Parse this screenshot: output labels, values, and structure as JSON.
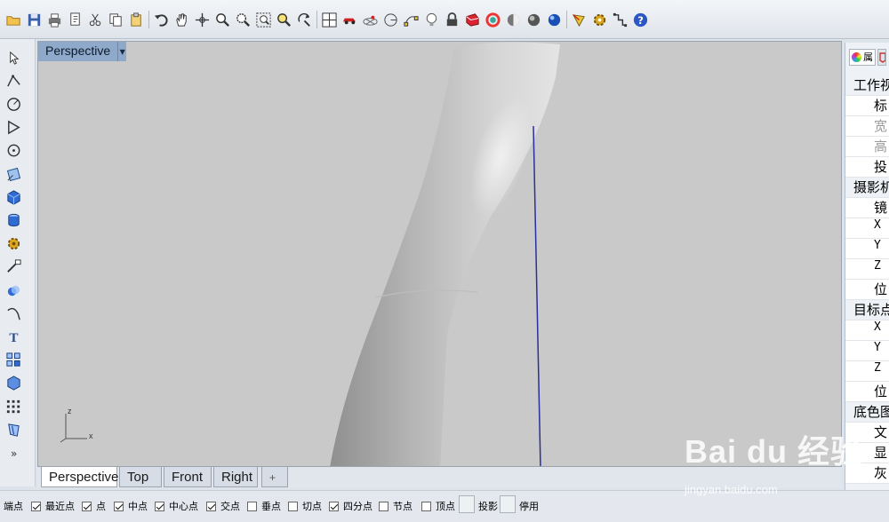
{
  "toolbar": {
    "icons": [
      "open-icon",
      "save-icon",
      "print-icon",
      "import-icon",
      "cut-icon",
      "copy-icon",
      "paste-icon",
      "undo-icon",
      "pan-hand-icon",
      "rotate-view-icon",
      "zoom-icon",
      "zoom-window-icon",
      "zoom-extents-icon",
      "zoom-selected-icon",
      "rotate-icon",
      "four-viewports-icon",
      "car-icon",
      "grid-icon",
      "osnap-icon",
      "point-edit-icon",
      "light-icon",
      "lock-icon",
      "layer-icon",
      "color-wheel-icon",
      "shaded-icon",
      "rendered-icon",
      "render-sphere-icon",
      "pen-icon",
      "gear-icon",
      "steps-icon",
      "help-icon"
    ]
  },
  "left_toolbar": {
    "icons": [
      "select-icon",
      "polyline-icon",
      "circle-icon",
      "polygon-icon",
      "ellipse-icon",
      "transform-icon",
      "box-icon",
      "cylinder-icon",
      "gear-solid-icon",
      "loft-icon",
      "boolean-icon",
      "curve-icon",
      "text-icon",
      "array-icon",
      "solid-icon",
      "grid-array-icon",
      "dimension-icon"
    ],
    "more": "»"
  },
  "viewport": {
    "title": "Perspective",
    "axis_x": "x",
    "axis_z": "z"
  },
  "tabs": [
    {
      "label": "Perspective",
      "active": true
    },
    {
      "label": "Top",
      "active": false
    },
    {
      "label": "Front",
      "active": false
    },
    {
      "label": "Right",
      "active": false
    }
  ],
  "tab_add": "+",
  "osnap": {
    "lead": "端点",
    "items": [
      {
        "label": "最近点",
        "checked": true
      },
      {
        "label": "点",
        "checked": true
      },
      {
        "label": "中点",
        "checked": true
      },
      {
        "label": "中心点",
        "checked": true
      },
      {
        "label": "交点",
        "checked": true
      },
      {
        "label": "垂点",
        "checked": false
      },
      {
        "label": "切点",
        "checked": false
      },
      {
        "label": "四分点",
        "checked": true
      },
      {
        "label": "节点",
        "checked": false
      },
      {
        "label": "顶点",
        "checked": false
      }
    ],
    "project": "投影",
    "disable": "停用"
  },
  "right_panel": {
    "tab_label": "属",
    "rows": [
      {
        "text": "工作视",
        "type": "group"
      },
      {
        "text": "标",
        "type": "item"
      },
      {
        "text": "宽",
        "type": "item",
        "dim": true
      },
      {
        "text": "高",
        "type": "item",
        "dim": true
      },
      {
        "text": "投",
        "type": "item"
      },
      {
        "text": "摄影机",
        "type": "group"
      },
      {
        "text": "镜",
        "type": "item"
      },
      {
        "text": "X",
        "type": "item",
        "mono": true
      },
      {
        "text": "Y",
        "type": "item",
        "mono": true
      },
      {
        "text": "Z",
        "type": "item",
        "mono": true
      },
      {
        "text": "位",
        "type": "item"
      },
      {
        "text": "目标点",
        "type": "group"
      },
      {
        "text": "X",
        "type": "item",
        "mono": true
      },
      {
        "text": "Y",
        "type": "item",
        "mono": true
      },
      {
        "text": "Z",
        "type": "item",
        "mono": true
      },
      {
        "text": "位",
        "type": "item"
      },
      {
        "text": "底色图",
        "type": "group"
      },
      {
        "text": "文",
        "type": "item"
      },
      {
        "text": "显",
        "type": "item"
      },
      {
        "text": "灰",
        "type": "item"
      }
    ]
  },
  "watermark": {
    "logo": "Bai du 经验",
    "url": "jingyan.baidu.com"
  }
}
